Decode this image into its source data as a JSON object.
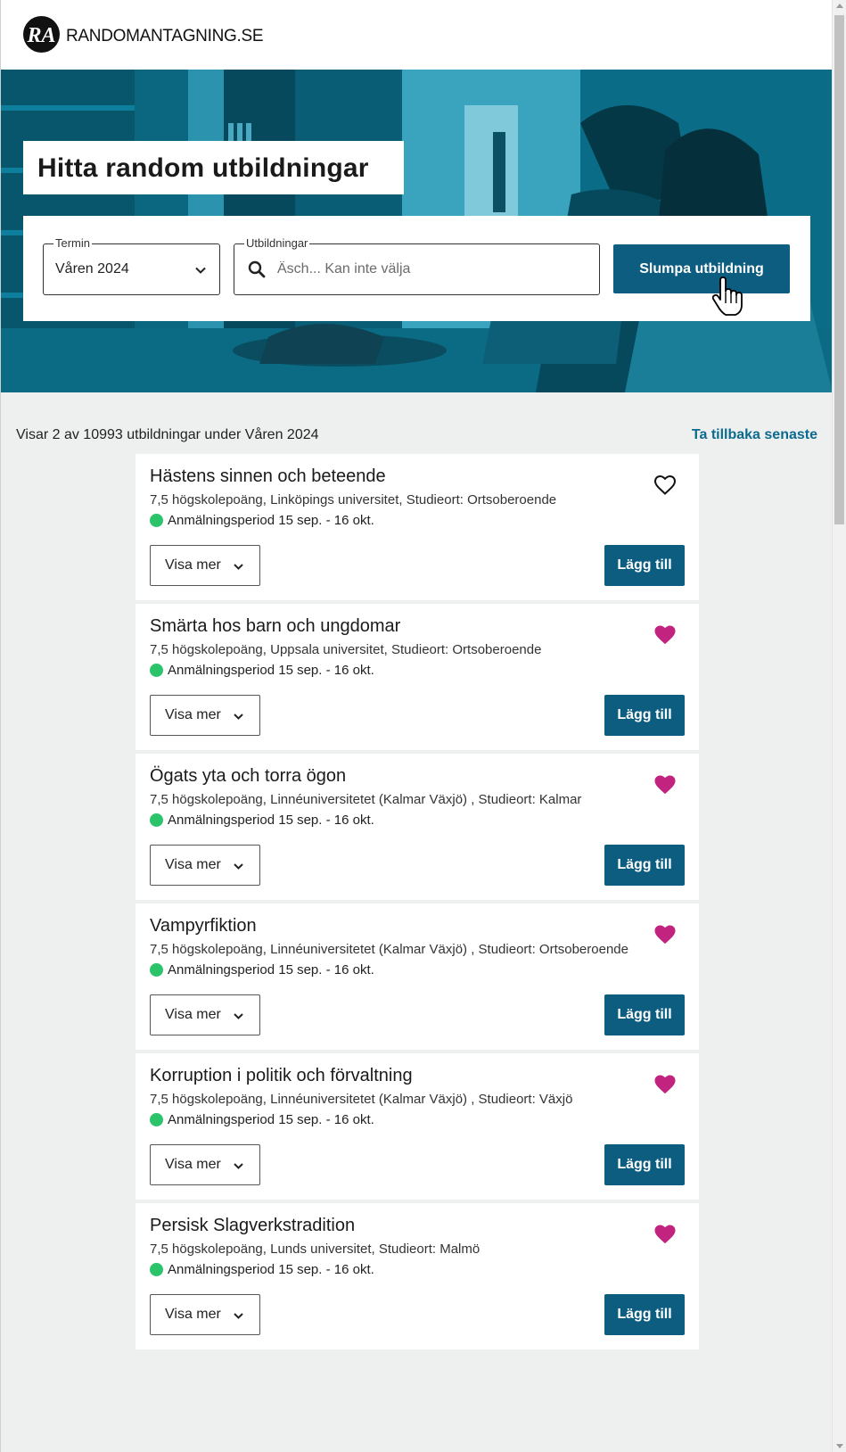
{
  "header": {
    "logo_text": "RA",
    "brand": "RANDOMANTAGNING.SE"
  },
  "hero": {
    "title": "Hitta random utbildningar"
  },
  "search": {
    "termin_label": "Termin",
    "termin_value": "Våren 2024",
    "utbildningar_label": "Utbildningar",
    "utbildningar_placeholder": "Äsch... Kan inte välja",
    "submit_label": "Slumpa utbildning"
  },
  "results": {
    "count_text": "Visar 2 av 10993 utbildningar under Våren 2024",
    "back_link": "Ta tillbaka senaste"
  },
  "card_labels": {
    "show_more": "Visa mer",
    "add": "Lägg till"
  },
  "colors": {
    "primary": "#0c5d80",
    "link": "#0c6a8e",
    "heart_filled": "#c2237f",
    "status_open": "#2bc46b",
    "hero_tint": "#0a6c86"
  },
  "courses": [
    {
      "title": "Hästens sinnen och beteende",
      "meta": "7,5 högskolepoäng, Linköpings universitet, Studieort: Ortsoberoende",
      "period": "Anmälningsperiod 15 sep. - 16 okt.",
      "favorite": false
    },
    {
      "title": "Smärta hos barn och ungdomar",
      "meta": "7,5 högskolepoäng, Uppsala universitet, Studieort: Ortsoberoende",
      "period": "Anmälningsperiod 15 sep. - 16 okt.",
      "favorite": true
    },
    {
      "title": "Ögats yta och torra ögon",
      "meta": "7,5 högskolepoäng, Linnéuniversitetet (Kalmar Växjö) , Studieort: Kalmar",
      "period": "Anmälningsperiod 15 sep. - 16 okt.",
      "favorite": true
    },
    {
      "title": "Vampyrfiktion",
      "meta": "7,5 högskolepoäng, Linnéuniversitetet (Kalmar Växjö) , Studieort: Ortsoberoende",
      "period": "Anmälningsperiod 15 sep. - 16 okt.",
      "favorite": true
    },
    {
      "title": "Korruption i politik och förvaltning",
      "meta": "7,5 högskolepoäng, Linnéuniversitetet (Kalmar Växjö) , Studieort: Växjö",
      "period": "Anmälningsperiod 15 sep. - 16 okt.",
      "favorite": true
    },
    {
      "title": "Persisk Slagverkstradition",
      "meta": "7,5 högskolepoäng, Lunds universitet, Studieort: Malmö",
      "period": "Anmälningsperiod 15 sep. - 16 okt.",
      "favorite": true
    }
  ]
}
